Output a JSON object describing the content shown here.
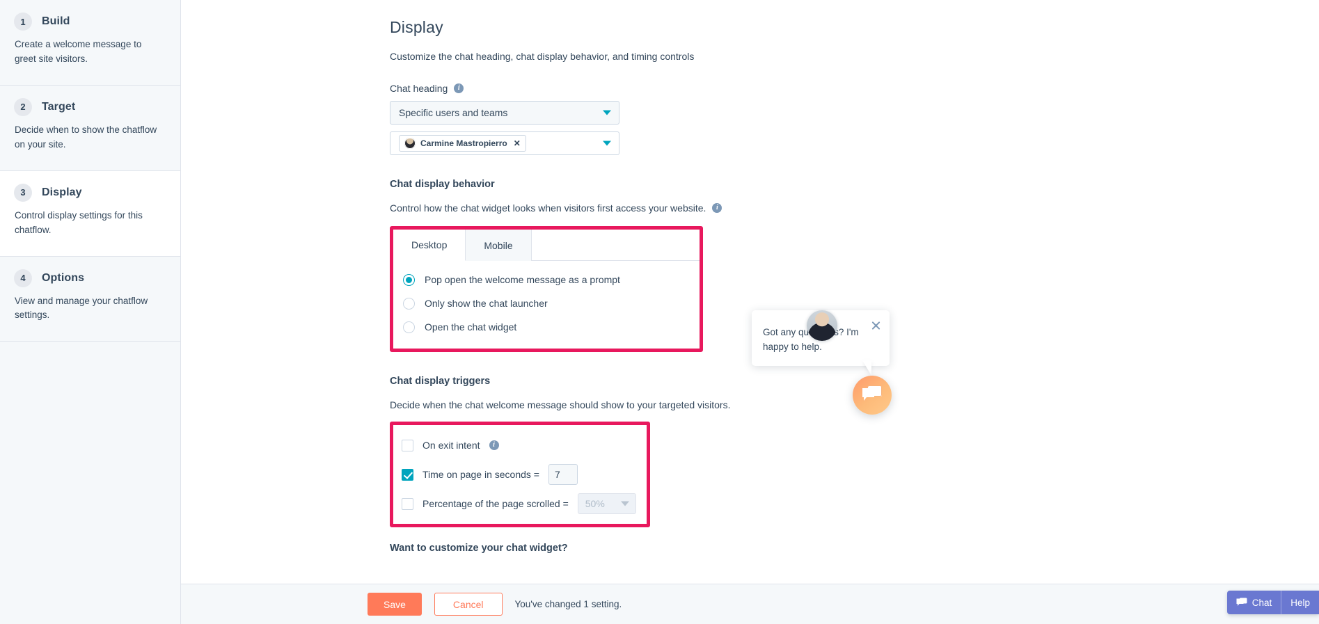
{
  "sidebar": {
    "steps": [
      {
        "number": "1",
        "title": "Build",
        "desc": "Create a welcome message to greet site visitors.",
        "active": false
      },
      {
        "number": "2",
        "title": "Target",
        "desc": "Decide when to show the chatflow on your site.",
        "active": false
      },
      {
        "number": "3",
        "title": "Display",
        "desc": "Control display settings for this chatflow.",
        "active": true
      },
      {
        "number": "4",
        "title": "Options",
        "desc": "View and manage your chatflow settings.",
        "active": false
      }
    ]
  },
  "page": {
    "title": "Display",
    "subtitle": "Customize the chat heading, chat display behavior, and timing controls"
  },
  "chat_heading": {
    "label": "Chat heading",
    "info_icon": "info-icon",
    "selected": "Specific users and teams",
    "caret_icon": "chevron-down-icon",
    "chip": {
      "avatar_icon": "user-avatar",
      "name": "Carmine Mastropierro",
      "remove_icon": "close-icon"
    }
  },
  "behavior": {
    "title": "Chat display behavior",
    "desc": "Control how the chat widget looks when visitors first access your website.",
    "info_icon": "info-icon",
    "tabs": [
      {
        "label": "Desktop",
        "active": true
      },
      {
        "label": "Mobile",
        "active": false
      }
    ],
    "options": [
      {
        "label": "Pop open the welcome message as a prompt",
        "checked": true
      },
      {
        "label": "Only show the chat launcher",
        "checked": false
      },
      {
        "label": "Open the chat widget",
        "checked": false
      }
    ]
  },
  "triggers": {
    "title": "Chat display triggers",
    "desc": "Decide when the chat welcome message should show to your targeted visitors.",
    "exit_intent": {
      "label": "On exit intent",
      "checked": false,
      "info_icon": "info-icon"
    },
    "time_on_page": {
      "label": "Time on page in seconds =",
      "checked": true,
      "value": "7"
    },
    "page_scrolled": {
      "label": "Percentage of the page scrolled =",
      "checked": false,
      "placeholder": "50%",
      "caret_icon": "chevron-down-icon"
    }
  },
  "customize": {
    "question": "Want to customize your chat widget?"
  },
  "footer": {
    "save_label": "Save",
    "cancel_label": "Cancel",
    "changed_note": "You've changed 1 setting."
  },
  "chat_preview": {
    "avatar_icon": "agent-avatar",
    "close_icon": "close-icon",
    "message": "Got any questions? I'm happy to help.",
    "launcher_icon": "chat-bubble-icon"
  },
  "help_bar": {
    "chat_label": "Chat",
    "chat_icon": "chat-bubble-icon",
    "help_label": "Help"
  },
  "colors": {
    "highlight": "#e8185d",
    "accent_teal": "#00a4bd",
    "brand_orange": "#ff7a59",
    "help_purple": "#6a78d1",
    "text": "#33475b"
  }
}
